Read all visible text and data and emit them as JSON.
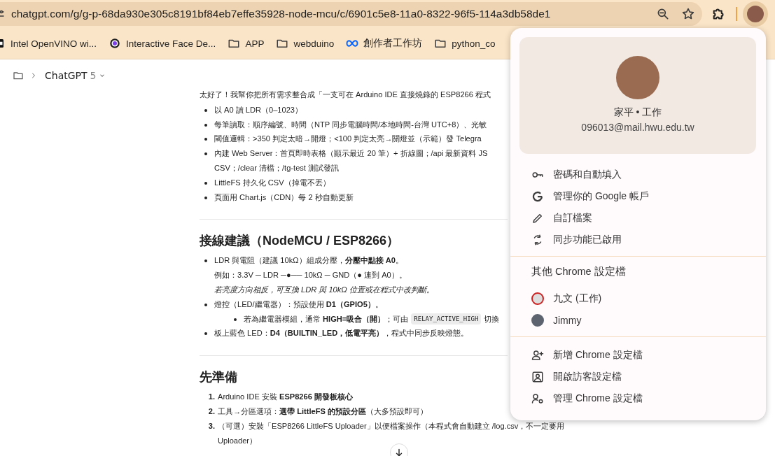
{
  "address_bar": {
    "url": "chatgpt.com/g/g-p-68da930e305c8191bf84eb7effe35928-node-mcu/c/6901c5e8-11a0-8322-96f5-114a3db58de1"
  },
  "bookmarks": [
    {
      "label": "Intel OpenVINO wi...",
      "kind": "square"
    },
    {
      "label": "Interactive Face De...",
      "kind": "circle"
    },
    {
      "label": "APP",
      "kind": "folder"
    },
    {
      "label": "webduino",
      "kind": "folder"
    },
    {
      "label": "創作者工作坊",
      "kind": "infinity"
    },
    {
      "label": "python_co",
      "kind": "folder"
    }
  ],
  "breadcrumb": {
    "title": "ChatGPT",
    "version": "5"
  },
  "article": {
    "intro": "太好了！我幫你把所有需求整合成「一支可在 Arduino IDE 直接燒錄的 ESP8266 程式",
    "bullets": [
      {
        "lines": [
          {
            "text": "以 A0 讀 LDR（0–1023）"
          }
        ]
      },
      {
        "lines": [
          {
            "text": "每筆讀取：順序編號、時間（NTP 同步電腦時間/本地時間-台灣 UTC+8）、光敏"
          }
        ]
      },
      {
        "lines": [
          {
            "text": "閾值邏輯：>350 判定太暗→開燈；<100 判定太亮→關燈並（示範）發 Telegra"
          }
        ]
      },
      {
        "lines": [
          {
            "text": "內建 Web Server：首頁即時表格（顯示最近 20 筆）+ 折線圖；/api 最新資料 JS"
          },
          {
            "text": "CSV；/clear 清檔；/tg-test 測試發訊"
          }
        ]
      },
      {
        "lines": [
          {
            "text": "LittleFS 持久化 CSV（掉電不丟）"
          }
        ]
      },
      {
        "lines": [
          {
            "text": "頁面用 Chart.js（CDN）每 2 秒自動更新"
          }
        ]
      }
    ],
    "sections": [
      {
        "heading": "接線建議（NodeMCU / ESP8266）",
        "items": [
          {
            "lines": [
              {
                "text": "LDR 與電阻（建議 10kΩ）組成分壓，**分壓中點接 A0**。"
              },
              {
                "text": "例如：3.3V ─ LDR ─●── 10kΩ ─ GND（● 連到 A0）。"
              },
              {
                "text": "若亮度方向相反，可互換 LDR 與 10kΩ 位置或在程式中改判斷。",
                "kind": "note"
              }
            ]
          },
          {
            "lines": [
              {
                "text": "燈控（LED/繼電器）：預設使用 **D1（GPIO5）**。"
              }
            ],
            "children": [
              {
                "lines": [
                  {
                    "text": "若為繼電器模組，通常 **HIGH=吸合（開）**；可由",
                    "code": "RELAY_ACTIVE_HIGH",
                    "after": "切換"
                  }
                ]
              }
            ]
          },
          {
            "lines": [
              {
                "text": "板上藍色 LED：**D4（BUILTIN_LED，低電平亮）**，程式中同步反映燈態。"
              }
            ]
          }
        ]
      },
      {
        "heading": "先準備",
        "items": [
          {
            "marker": "1.",
            "lines": [
              {
                "text": "Arduino IDE 安裝 **ESP8266 開發板核心**"
              }
            ]
          },
          {
            "marker": "2.",
            "lines": [
              {
                "text": "工具→分區選項：**選帶 LittleFS 的預設分區**（大多預設即可）"
              }
            ]
          },
          {
            "marker": "3.",
            "lines": [
              {
                "text": "（可選）安裝「ESP8266 LittleFS Uploader」以便檔案操作（本程式會自動建立 /log.csv，不一定要用"
              },
              {
                "text": "Uploader）"
              }
            ]
          }
        ]
      }
    ]
  },
  "profile_menu": {
    "name": "家平 • 工作",
    "email": "096013@mail.hwu.edu.tw",
    "items": [
      {
        "label": "密碼和自動填入",
        "kind": "key"
      },
      {
        "label": "管理你的 Google 帳戶",
        "kind": "google"
      },
      {
        "label": "自訂檔案",
        "kind": "pencil"
      },
      {
        "label": "同步功能已啟用",
        "kind": "sync"
      }
    ],
    "others_title": "其他 Chrome 設定檔",
    "profiles": [
      {
        "name": "九文 (工作)",
        "kind": "cartoon"
      },
      {
        "name": "Jimmy",
        "kind": "person"
      }
    ],
    "actions": [
      {
        "label": "新增 Chrome 設定檔",
        "kind": "add-person"
      },
      {
        "label": "開啟訪客設定檔",
        "kind": "guest"
      },
      {
        "label": "管理 Chrome 設定檔",
        "kind": "manage"
      }
    ]
  }
}
